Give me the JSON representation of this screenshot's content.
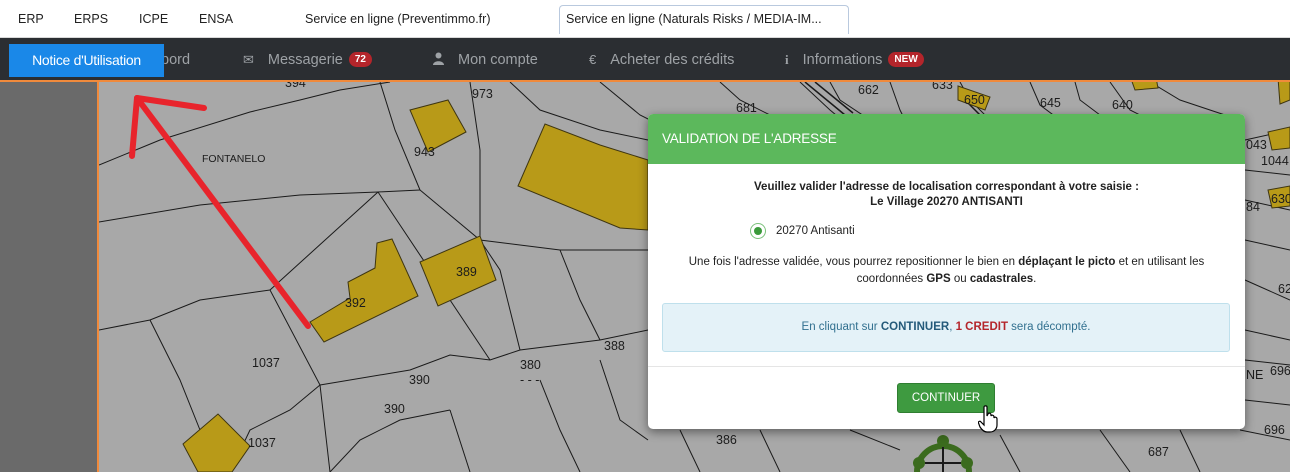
{
  "browser": {
    "tabs": [
      {
        "label": "ERP"
      },
      {
        "label": "ERPS"
      },
      {
        "label": "ICPE"
      },
      {
        "label": "ENSA"
      },
      {
        "label": "Service en ligne (Preventimmo.fr)"
      },
      {
        "label": "Service en ligne (Naturals Risks / MEDIA-IM..."
      }
    ]
  },
  "nav": {
    "notice_label": "Notice d'Utilisation",
    "dashboard_partial": "bord",
    "items": [
      {
        "label": "Messagerie",
        "icon": "envelope-icon",
        "badge": "72"
      },
      {
        "label": "Mon compte",
        "icon": "user-icon"
      },
      {
        "label": "Acheter des crédits",
        "icon": "euro-icon"
      },
      {
        "label": "Informations",
        "icon": "info-icon",
        "badge": "NEW"
      }
    ],
    "accent_color": "#f08a3c",
    "badge_color": "#b4252b"
  },
  "map": {
    "place_name": "FONTANELO",
    "parcels": [
      "394",
      "973",
      "943",
      "681",
      "662",
      "633",
      "650",
      "645",
      "640",
      "392",
      "389",
      "1037",
      "1037",
      "380",
      "388",
      "390",
      "390",
      "386",
      "687",
      "696",
      "696",
      "1044",
      "630",
      "62",
      "043",
      "84",
      "NE"
    ]
  },
  "modal": {
    "title": "VALIDATION DE L'ADRESSE",
    "header_color": "#5cb85c",
    "prompt": "Veuillez valider l'adresse de localisation correspondant à votre saisie :",
    "address": "Le Village 20270 ANTISANTI",
    "option": "20270 Antisanti",
    "note_part1": "Une fois l'adresse validée, vous pourrez repositionner le bien en ",
    "note_bold1": "déplaçant le picto",
    "note_part2": " et en utilisant les",
    "note_part3": "coordonnées ",
    "note_bold2": "GPS",
    "note_part4": " ou ",
    "note_bold3": "cadastrales",
    "note_part5": ".",
    "info_part1": "En cliquant sur ",
    "info_continue": "CONTINUER",
    "info_part2": ", ",
    "info_credit": "1 CREDIT",
    "info_part3": " sera décompté.",
    "button": "CONTINUER",
    "button_color": "#3e9a40"
  }
}
